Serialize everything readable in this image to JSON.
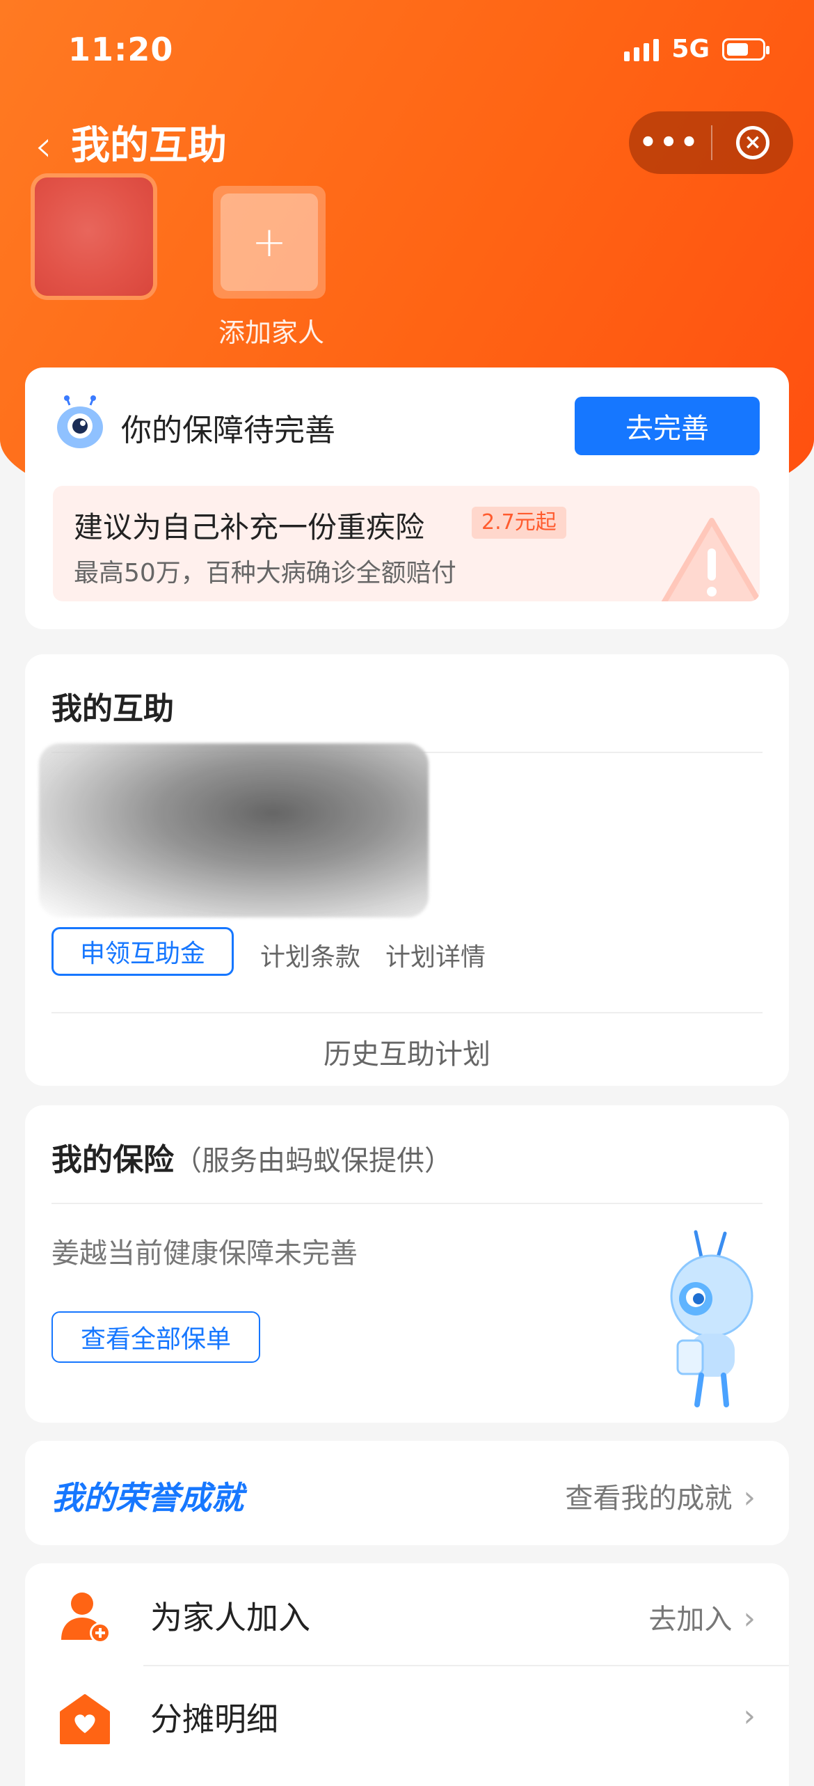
{
  "status_bar": {
    "time": "11:20",
    "network": "5G"
  },
  "nav": {
    "back_icon": "chevron-left",
    "title": "我的互助",
    "more_icon": "more-dots",
    "close_icon": "close-circle"
  },
  "members": {
    "add_label": "添加家人"
  },
  "protection_card": {
    "label": "你的保障待完善",
    "button": "去完善",
    "tip_title": "建议为自己补充一份重疾险",
    "tip_badge": "2.7元起",
    "tip_desc": "最高50万，百种大病确诊全额赔付"
  },
  "mutual_card": {
    "title": "我的互助",
    "claim_button": "申领互助金",
    "terms_link": "计划条款",
    "details_link": "计划详情",
    "history_link": "历史互助计划"
  },
  "insurance_card": {
    "title": "我的保险",
    "subtitle": "（服务由蚂蚁保提供）",
    "desc": "姜越当前健康保障未完善",
    "view_button": "查看全部保单"
  },
  "honor_card": {
    "title": "我的荣誉成就",
    "link": "查看我的成就"
  },
  "menu": [
    {
      "label": "为家人加入",
      "action": "去加入",
      "icon": "add-user-icon"
    },
    {
      "label": "分摊明细",
      "action": "",
      "icon": "house-heart-icon"
    }
  ],
  "colors": {
    "brand_orange": "#ff6414",
    "primary_blue": "#1677ff"
  }
}
